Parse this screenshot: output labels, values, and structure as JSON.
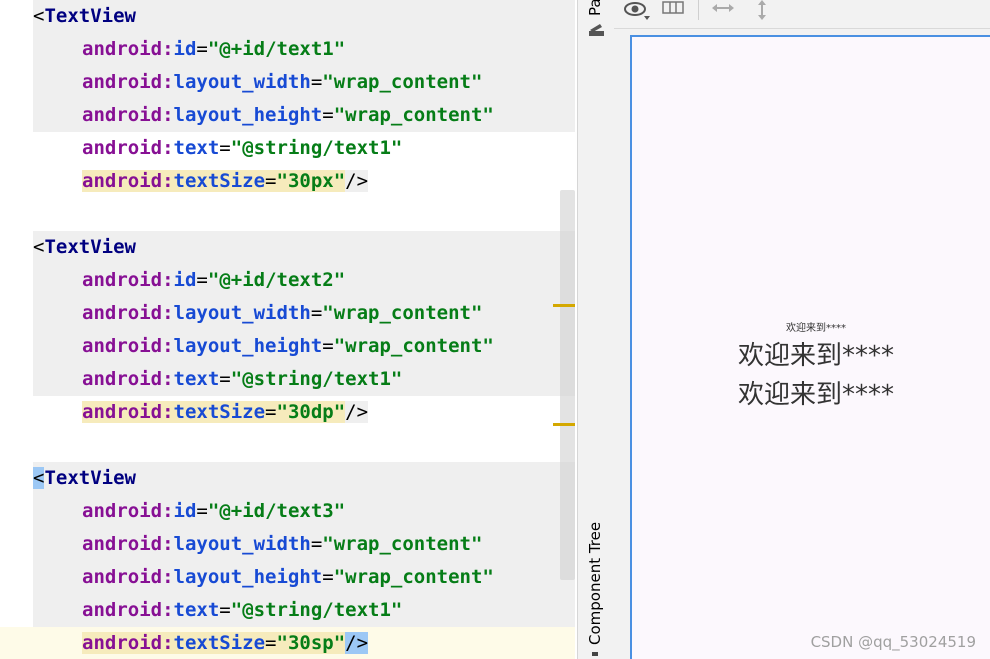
{
  "editor": {
    "blocks": [
      {
        "open_tag": "TextView",
        "attrs": [
          {
            "ns": "android",
            "name": "id",
            "value": "\"@+id/text1\""
          },
          {
            "ns": "android",
            "name": "layout_width",
            "value": "\"wrap_content\""
          },
          {
            "ns": "android",
            "name": "layout_height",
            "value": "\"wrap_content\""
          },
          {
            "ns": "android",
            "name": "text",
            "value": "\"@string/text1\""
          },
          {
            "ns": "android",
            "name": "textSize",
            "value": "\"30px\"",
            "close": "/>"
          }
        ]
      },
      {
        "open_tag": "TextView",
        "attrs": [
          {
            "ns": "android",
            "name": "id",
            "value": "\"@+id/text2\""
          },
          {
            "ns": "android",
            "name": "layout_width",
            "value": "\"wrap_content\""
          },
          {
            "ns": "android",
            "name": "layout_height",
            "value": "\"wrap_content\""
          },
          {
            "ns": "android",
            "name": "text",
            "value": "\"@string/text1\""
          },
          {
            "ns": "android",
            "name": "textSize",
            "value": "\"30dp\"",
            "close": "/>"
          }
        ]
      },
      {
        "open_tag": "TextView",
        "attrs": [
          {
            "ns": "android",
            "name": "id",
            "value": "\"@+id/text3\""
          },
          {
            "ns": "android",
            "name": "layout_width",
            "value": "\"wrap_content\""
          },
          {
            "ns": "android",
            "name": "layout_height",
            "value": "\"wrap_content\""
          },
          {
            "ns": "android",
            "name": "text",
            "value": "\"@string/text1\""
          },
          {
            "ns": "android",
            "name": "textSize",
            "value": "\"30sp\"",
            "close": "/>"
          }
        ]
      }
    ]
  },
  "sidepanel": {
    "top_label": "Pa",
    "bottom_label": "Component Tree"
  },
  "toolbar": {
    "icons": [
      "eye-icon",
      "columns-icon",
      "horizontal-resize-icon",
      "vertical-resize-icon"
    ]
  },
  "preview": {
    "text_small": "欢迎来到****",
    "text_large_1": "欢迎来到****",
    "text_large_2": "欢迎来到****"
  },
  "watermark": "CSDN @qq_53024519",
  "colors": {
    "tag": "#000080",
    "attr_ns": "#871094",
    "attr_name": "#174ad4",
    "value": "#067d17",
    "highlight": "#f6ebbc",
    "line_bg": "#efefef"
  }
}
